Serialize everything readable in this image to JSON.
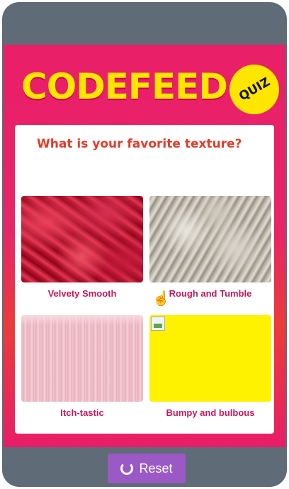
{
  "app": {
    "logo_text": "CODEFEED",
    "badge_text": "QUIZ"
  },
  "quiz": {
    "question": "What is your favorite texture?",
    "options": [
      {
        "label": "Velvety Smooth",
        "image": "red-velvet-texture"
      },
      {
        "label": "Rough and Tumble",
        "image": "grey-rock-texture"
      },
      {
        "label": "Itch-tastic",
        "image": "pink-fiberglass-texture"
      },
      {
        "label": "Bumpy and bulbous",
        "image": "broken-image-yellow"
      }
    ]
  },
  "footer": {
    "reset_label": "Reset",
    "reset_icon": "refresh-icon"
  },
  "colors": {
    "brand_pink": "#e91f68",
    "logo_yellow": "#ffe600",
    "question_red": "#e43b2a",
    "label_pink": "#c7175c",
    "reset_purple": "#9b59c6"
  }
}
